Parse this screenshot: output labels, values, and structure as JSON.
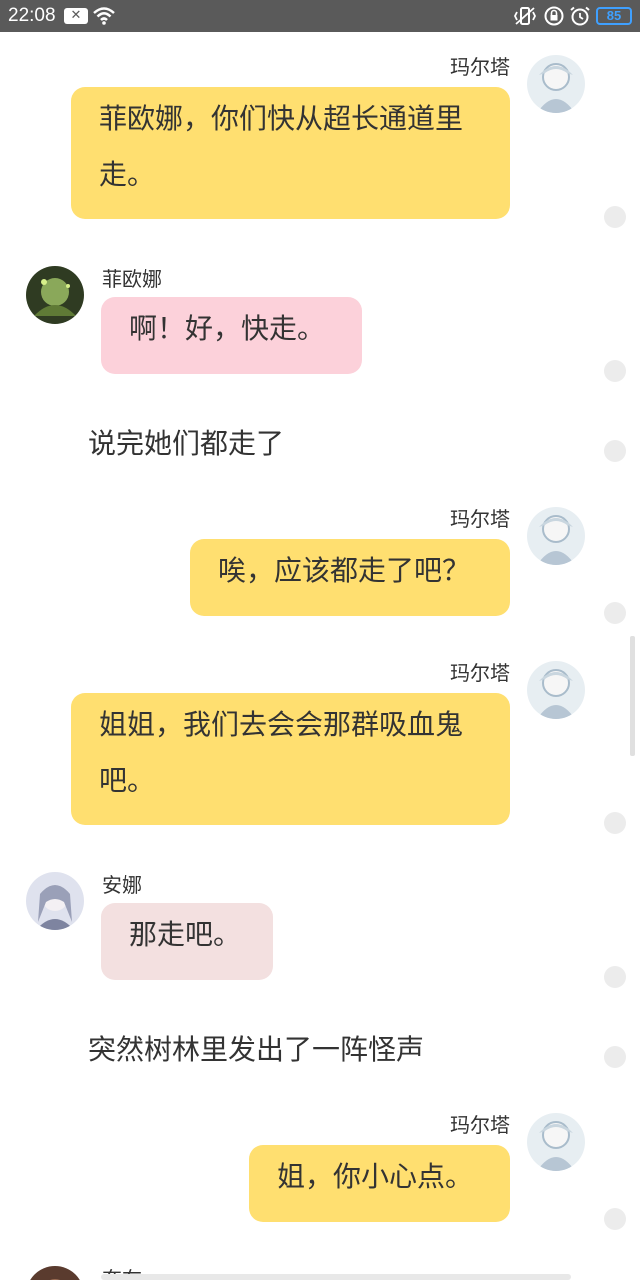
{
  "status_bar": {
    "time": "22:08",
    "battery": "85",
    "icons": [
      "close-box-icon",
      "wifi-icon",
      "vibrate-icon",
      "rotation-lock-icon",
      "alarm-icon",
      "battery-icon"
    ]
  },
  "messages": [
    {
      "type": "bubble",
      "side": "right",
      "name": "玛尔塔",
      "text": "菲欧娜，你们快从超长通道里走。",
      "color": "#ffdf70"
    },
    {
      "type": "bubble",
      "side": "left",
      "name": "菲欧娜",
      "text": "啊！好，快走。",
      "color": "#fcd1da"
    },
    {
      "type": "narration",
      "text": "说完她们都走了"
    },
    {
      "type": "bubble",
      "side": "right",
      "name": "玛尔塔",
      "text": "唉，应该都走了吧？",
      "color": "#ffdf70"
    },
    {
      "type": "bubble",
      "side": "right",
      "name": "玛尔塔",
      "text": "姐姐，我们去会会那群吸血鬼吧。",
      "color": "#ffdf70"
    },
    {
      "type": "bubble",
      "side": "left",
      "name": "安娜",
      "text": "那走吧。",
      "color": "#f3e0e0"
    },
    {
      "type": "narration",
      "text": "突然树林里发出了一阵怪声"
    },
    {
      "type": "bubble",
      "side": "right",
      "name": "玛尔塔",
      "text": "姐，你小心点。",
      "color": "#ffdf70"
    },
    {
      "type": "bubble",
      "side": "left",
      "name": "奈布",
      "text": ""
    }
  ],
  "msg_line_breaks": {
    "m0_line1": "菲欧娜，你们快从超长通道里",
    "m0_line2": "走。",
    "m4_line1": "姐姐，我们去会会那群吸血鬼",
    "m4_line2": "吧。"
  }
}
